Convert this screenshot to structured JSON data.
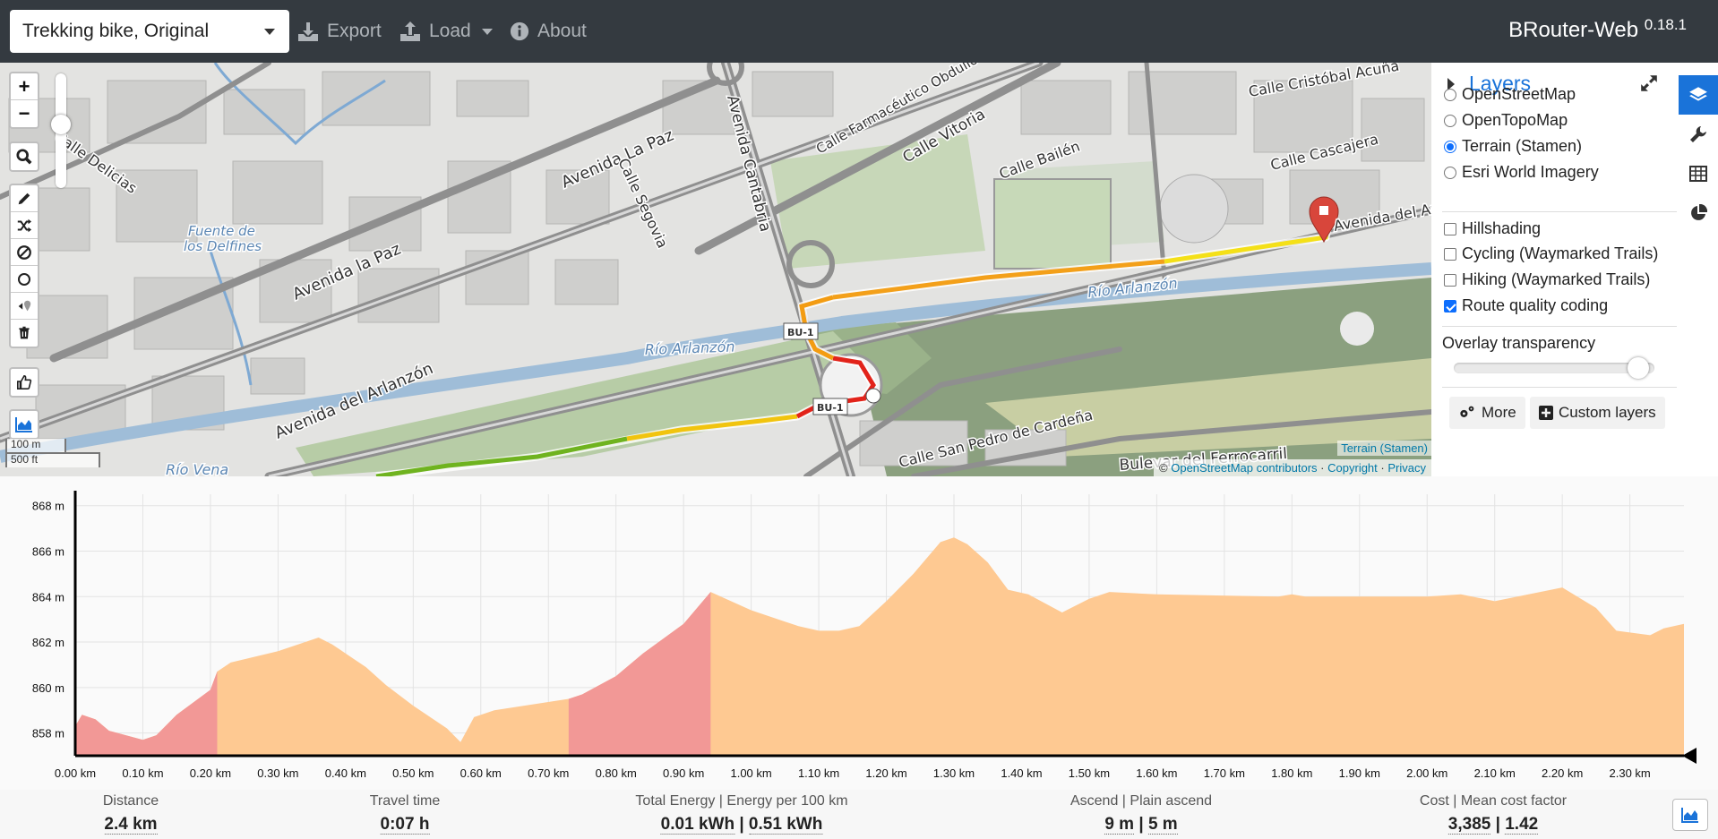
{
  "topbar": {
    "profile": "Trekking bike, Original",
    "export": "Export",
    "load": "Load",
    "about": "About",
    "brand": "BRouter-Web",
    "version": "0.18.1"
  },
  "map": {
    "streets": [
      "Calle Delicias",
      "Avenida La Paz",
      "Avenida la Paz",
      "Calle Segovia",
      "Avenida Cantabria",
      "Calle Farmacéutico Obdulio",
      "Calle Vitoria",
      "Calle Bailén",
      "Calle Cristóbal Acuña",
      "Calle Cascajera",
      "Avenida del Arlanzón",
      "Avenida del Arl",
      "Río Arlanzón",
      "Río Arlanzón",
      "Fuente de",
      "los Delfines",
      "Calle San Pedro de Cardeña",
      "Bulevar del Ferrocarril",
      "Río Vena",
      "BU-1",
      "BU-1"
    ],
    "scale_metric": "100 m",
    "scale_imperial": "500 ft",
    "attribution_prefix": "©",
    "attribution_osm": "OpenStreetMap contributors",
    "attribution_sep1": "·",
    "attribution_copyright": "Copyright",
    "attribution_sep2": "·",
    "attribution_privacy": "Privacy",
    "terrain_tag": "Terrain (Stamen)"
  },
  "layers": {
    "title": "Layers",
    "base": [
      {
        "label": "OpenStreetMap",
        "selected": false
      },
      {
        "label": "OpenTopoMap",
        "selected": false
      },
      {
        "label": "Terrain (Stamen)",
        "selected": true
      },
      {
        "label": "Esri World Imagery",
        "selected": false
      }
    ],
    "overlays": [
      {
        "label": "Hillshading",
        "checked": false
      },
      {
        "label": "Cycling (Waymarked Trails)",
        "checked": false
      },
      {
        "label": "Hiking (Waymarked Trails)",
        "checked": false
      },
      {
        "label": "Route quality coding",
        "checked": true
      }
    ],
    "overlay_transparency_label": "Overlay transparency",
    "overlay_transparency": 0.92,
    "more": "More",
    "custom_layers": "Custom layers"
  },
  "chart_data": {
    "type": "area",
    "title": "",
    "xlabel": "",
    "ylabel": "",
    "xlim": [
      0,
      2.38
    ],
    "ylim": [
      857,
      868.5
    ],
    "x_ticks": [
      "0.00 km",
      "0.10 km",
      "0.20 km",
      "0.30 km",
      "0.40 km",
      "0.50 km",
      "0.60 km",
      "0.70 km",
      "0.80 km",
      "0.90 km",
      "1.00 km",
      "1.10 km",
      "1.20 km",
      "1.30 km",
      "1.40 km",
      "1.50 km",
      "1.60 km",
      "1.70 km",
      "1.80 km",
      "1.90 km",
      "2.00 km",
      "2.10 km",
      "2.20 km",
      "2.30 km"
    ],
    "y_ticks": [
      "858 m",
      "860 m",
      "862 m",
      "864 m",
      "866 m",
      "868 m"
    ],
    "x": [
      0.0,
      0.01,
      0.03,
      0.05,
      0.1,
      0.12,
      0.15,
      0.2,
      0.21,
      0.23,
      0.3,
      0.36,
      0.38,
      0.41,
      0.43,
      0.46,
      0.5,
      0.55,
      0.57,
      0.59,
      0.62,
      0.73,
      0.75,
      0.8,
      0.84,
      0.9,
      0.94,
      1.0,
      1.05,
      1.07,
      1.1,
      1.13,
      1.16,
      1.2,
      1.24,
      1.28,
      1.3,
      1.32,
      1.35,
      1.38,
      1.41,
      1.46,
      1.5,
      1.53,
      1.6,
      1.78,
      1.8,
      1.82,
      1.9,
      2.0,
      2.05,
      2.1,
      2.2,
      2.25,
      2.28,
      2.33,
      2.35,
      2.38
    ],
    "y": [
      858.3,
      858.8,
      858.6,
      858.1,
      857.7,
      857.9,
      858.8,
      859.9,
      860.7,
      861.1,
      861.6,
      862.2,
      861.9,
      861.3,
      860.9,
      860.1,
      859.2,
      858.2,
      857.6,
      858.7,
      859.0,
      859.5,
      859.7,
      860.5,
      861.5,
      862.8,
      864.2,
      863.4,
      862.9,
      862.7,
      862.5,
      862.5,
      862.7,
      863.8,
      865.0,
      866.4,
      866.6,
      866.3,
      865.5,
      864.3,
      864.1,
      863.3,
      863.9,
      864.2,
      864.1,
      864.0,
      864.1,
      864.0,
      864.0,
      864.0,
      864.1,
      863.8,
      864.4,
      863.5,
      862.5,
      862.3,
      862.6,
      862.8
    ],
    "steep_segments_km": [
      [
        0.0,
        0.21
      ],
      [
        0.73,
        0.94
      ]
    ],
    "colors": {
      "fill": "#fec992",
      "steep": "#f29896",
      "axis": "#000000",
      "grid": "#e3e3e3"
    }
  },
  "stats": [
    {
      "label": "Distance",
      "values": [
        "2.4 km"
      ]
    },
    {
      "label": "Travel time",
      "values": [
        "0:07 h"
      ]
    },
    {
      "label": "Total Energy | Energy per 100 km",
      "values": [
        "0.01 kWh",
        "0.51 kWh"
      ]
    },
    {
      "label": "Ascend | Plain ascend",
      "values": [
        "9 m",
        "5 m"
      ]
    },
    {
      "label": "Cost | Mean cost factor",
      "values": [
        "3,385",
        "1.42"
      ]
    }
  ],
  "icons": {
    "export": "download-icon",
    "load": "upload-icon",
    "about": "info-icon",
    "draw": "pencil-icon",
    "reverse": "shuffle-icon",
    "nogo": "ban-icon",
    "circle": "circle-icon",
    "beeline": "beeline-icon",
    "delete": "trash-icon",
    "thumb": "thumbs-up-icon",
    "elevation": "area-chart-icon"
  }
}
